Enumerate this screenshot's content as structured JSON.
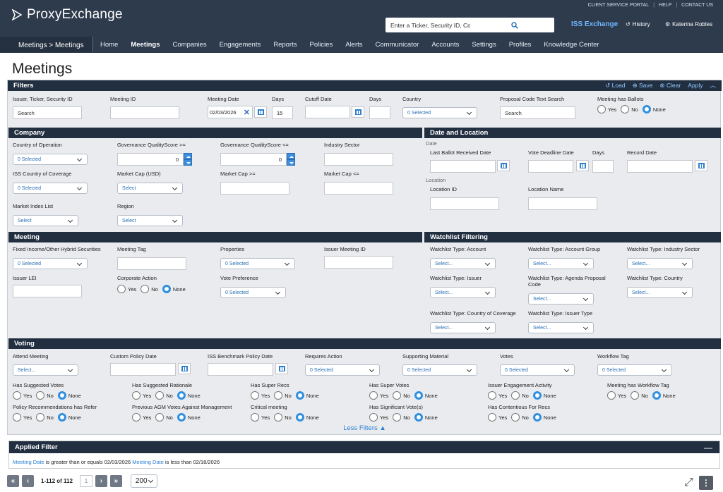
{
  "header": {
    "app_name": "ProxyExchange",
    "top_links": [
      "CLIENT SERVICE PORTAL",
      "HELP",
      "CONTACT US"
    ],
    "search_placeholder": "Enter a Ticker, Security ID, Company Name, or Meeting",
    "iss_label": "ISS Exchange",
    "history_label": "History",
    "user_name": "Katerina Robles"
  },
  "nav": {
    "breadcrumb": "Meetings > Meetings",
    "items": [
      "Home",
      "Meetings",
      "Companies",
      "Engagements",
      "Reports",
      "Policies",
      "Alerts",
      "Communicator",
      "Accounts",
      "Settings",
      "Profiles",
      "Knowledge Center"
    ],
    "active": "Meetings"
  },
  "page_title": "Meetings",
  "filters": {
    "title": "Filters",
    "actions": [
      "Load",
      "Save",
      "Clear",
      "Apply"
    ],
    "top": {
      "issuer_label": "Issuer, Ticker, Security ID",
      "issuer_placeholder": "Search",
      "meeting_id_label": "Meeting ID",
      "meeting_date_label": "Meeting Date",
      "meeting_date_value": "02/03/2026",
      "days_label": "Days",
      "days_value": "15",
      "cutoff_label": "Cutoff Date",
      "days2_label": "Days",
      "country_label": "Country",
      "country_value": "0 Selected",
      "proposal_label": "Proposal Code Text Search",
      "proposal_placeholder": "Search",
      "ballots_label": "Meeting has Ballots"
    },
    "radio_options": [
      "Yes",
      "No",
      "None"
    ],
    "company": {
      "title": "Company",
      "fields": {
        "country_op": "Country of Operation",
        "country_op_val": "0 Selected",
        "gqs_ge": "Governance QualityScore >=",
        "gqs_ge_val": "0",
        "gqs_le": "Governance QualityScore <=",
        "gqs_le_val": "0",
        "industry": "Industry Sector",
        "iss_country": "ISS Country of Coverage",
        "iss_country_val": "0 Selected",
        "mcap": "Market Cap (USD)",
        "mcap_val": "Select",
        "mcap_ge": "Market Cap >=",
        "mcap_le": "Market Cap <=",
        "index": "Market Index List",
        "index_val": "Select",
        "region": "Region",
        "region_val": "Select"
      }
    },
    "date_location": {
      "title": "Date and Location",
      "date_sub": "Date",
      "last_ballot": "Last Ballot Received Date",
      "vote_deadline": "Vote Deadline Date",
      "days": "Days",
      "record_date": "Record Date",
      "location_sub": "Location",
      "location_id": "Location ID",
      "location_name": "Location Name"
    },
    "meeting": {
      "title": "Meeting",
      "fixed_income": "Fixed Income/Other Hybrid Securities",
      "fixed_income_val": "0 Selected",
      "tag": "Meeting Tag",
      "properties": "Properties",
      "properties_val": "0 Selected",
      "issuer_mid": "Issuer Meeting ID",
      "lei": "Issuer LEI",
      "corp_action": "Corporate Action",
      "vote_pref": "Vote Preference",
      "vote_pref_val": "0 Selected"
    },
    "watchlist": {
      "title": "Watchlist Filtering",
      "account": "Watchlist Type: Account",
      "account_group": "Watchlist Type: Account Group",
      "industry": "Watchlist Type: Industry Sector",
      "issuer": "Watchlist Type: Issuer",
      "agenda": "Watchlist Type: Agenda Proposal Code",
      "country": "Watchlist Type: Country",
      "coverage": "Watchlist Type: Country of Coverage",
      "issuer_type": "Watchlist Type: Issuer Type",
      "select_val": "Select..."
    },
    "voting": {
      "title": "Voting",
      "attend": "Attend Meeting",
      "attend_val": "Select...",
      "custom_policy": "Custom Policy Date",
      "iss_bench": "ISS Benchmark Policy Date",
      "requires_action": "Requires Action",
      "requires_action_val": "0 Selected",
      "supporting": "Supporting Material",
      "supporting_val": "0 Selected",
      "votes": "Votes",
      "votes_val": "0 Selected",
      "workflow": "Workflow Tag",
      "workflow_val": "0 Selected",
      "radio_groups": [
        "Has Suggested Votes",
        "Has Suggested Rationale",
        "Has Super Recs",
        "Has Super Votes",
        "Issuer Engagement Activity",
        "Meeting has Workflow Tag",
        "Policy Recommendations has Refer",
        "Previous AGM Votes Against Management",
        "Critical meeting",
        "Has Significant Vote(s)",
        "Has Contentious For Recs"
      ]
    },
    "less_filters": "Less Filters"
  },
  "applied": {
    "title": "Applied Filter",
    "k1": "Meeting Date",
    "t1": " is greater than or equals 02/03/2026 ",
    "k2": "Meeting Date",
    "t2": " is less than 02/18/2026"
  },
  "pager": {
    "count": "1-112 of 112",
    "page": "1",
    "size": "200"
  }
}
